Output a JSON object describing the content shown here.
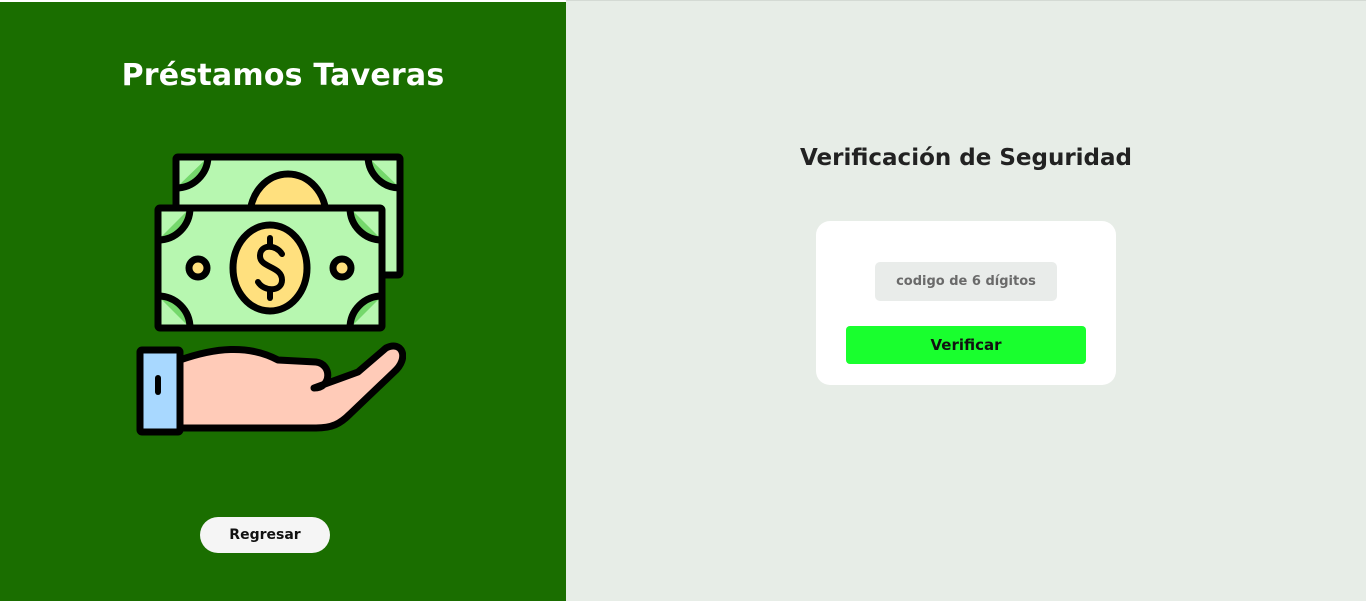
{
  "left_panel": {
    "brand_title": "Préstamos Taveras",
    "illustration_icon": "money-hand-icon",
    "back_button_label": "Regresar",
    "background_color": "#1a6e00"
  },
  "main": {
    "title": "Verificación de Seguridad",
    "code_input": {
      "placeholder": "codigo de 6 dígitos",
      "value": ""
    },
    "verify_button_label": "Verificar",
    "accent_color": "#19ff2e",
    "background_color": "#e7ede7"
  }
}
